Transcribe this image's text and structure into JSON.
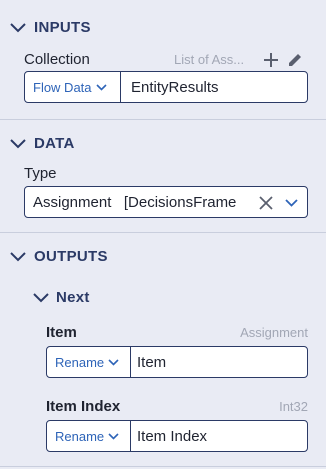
{
  "inputs": {
    "title": "INPUTS",
    "collection_label": "Collection",
    "collection_hint": "List of Ass...",
    "source_label": "Flow Data",
    "collection_value": "EntityResults"
  },
  "data": {
    "title": "DATA",
    "type_label": "Type",
    "type_value": "Assignment   [DecisionsFrame"
  },
  "outputs": {
    "title": "OUTPUTS",
    "next_title": "Next",
    "item_label": "Item",
    "item_hint": "Assignment",
    "item_mode": "Rename",
    "item_value": "Item",
    "index_label": "Item Index",
    "index_hint": "Int32",
    "index_mode": "Rename",
    "index_value": "Item Index"
  },
  "colors": {
    "accent": "#2b3a66",
    "link": "#2e64b8",
    "background": "#e9ebf4"
  }
}
